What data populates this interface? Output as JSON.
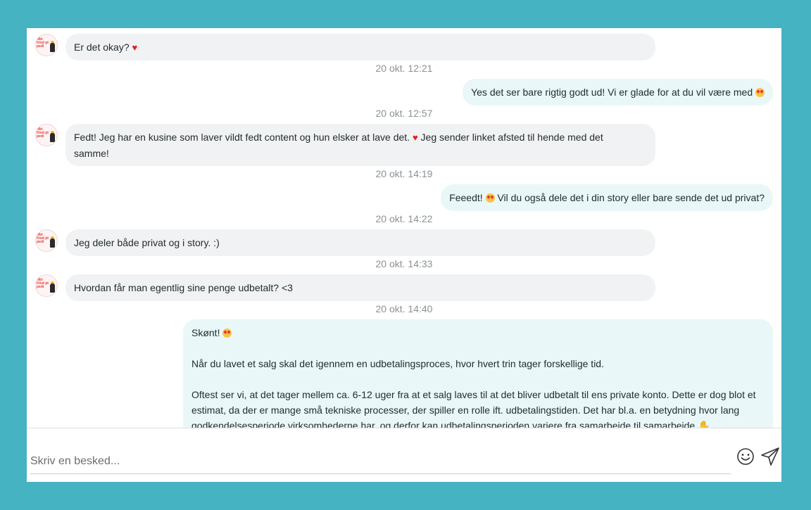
{
  "messages": [
    {
      "from": "them",
      "text": "Er det okay?",
      "emoji": "heart",
      "time": "20 okt. 12:21"
    },
    {
      "from": "me",
      "text": "Yes det ser bare rigtig godt ud! Vi er glade for at du vil være med",
      "emoji": "heart-eyes",
      "time": "20 okt. 12:57"
    },
    {
      "from": "them",
      "line1": "Fedt! Jeg har en kusine som laver vildt fedt content og hun elsker at lave det.",
      "line1b": "Jeg sender linket afsted til hende med det",
      "line2": "samme!",
      "emoji": "heart",
      "time": "20 okt. 14:19"
    },
    {
      "from": "me",
      "pre": "Feeedt!",
      "text": "Vil du også dele det i din story eller bare sende det ud privat?",
      "emoji": "heart-eyes",
      "time": "20 okt. 14:22"
    },
    {
      "from": "them",
      "text": "Jeg deler både privat og i story. :)",
      "time": "20 okt. 14:33"
    },
    {
      "from": "them",
      "text": "Hvordan får man egentlig sine penge udbetalt? <3",
      "time": "20 okt. 14:40"
    },
    {
      "from": "me",
      "greeting": "Skønt!",
      "p1": "Når du lavet et salg skal det igennem en udbetalingsproces, hvor hvert trin tager forskellige tid.",
      "p2": "Oftest ser vi, at det tager mellem ca. 6-12 uger fra at et salg laves til at det bliver udbetalt til ens private konto. Dette er dog blot et estimat, da der er mange små tekniske processer, der spiller en rolle ift. udbetalingstiden. Det har bl.a. en betydning hvor lang godkendelsesperiode virksomhederne har, og derfor kan udbetalingsperioden variere fra samarbejde til samarbejde",
      "emoji": "heart-eyes"
    }
  ],
  "avatar": {
    "text": "Mbi frivd pt pedi"
  },
  "composer": {
    "placeholder": "Skriv en besked..."
  },
  "icons": {
    "emoji_button": "smiley-icon",
    "send_button": "send-icon"
  }
}
